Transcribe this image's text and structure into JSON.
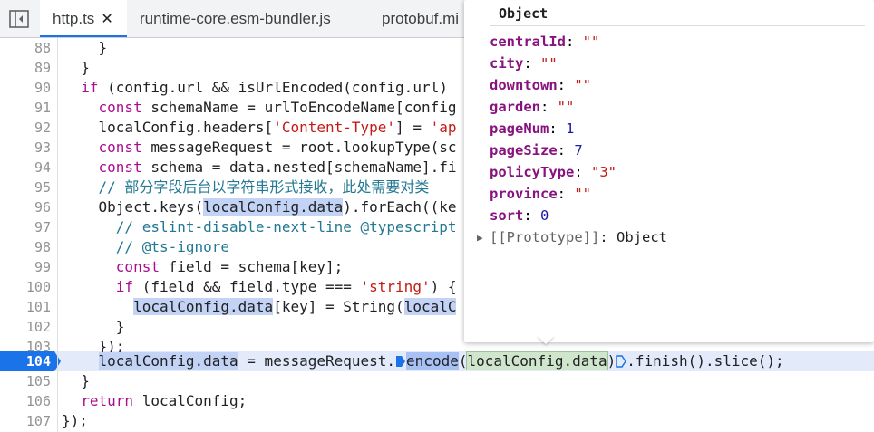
{
  "tabs": [
    {
      "label": "http.ts",
      "close": "✕",
      "active": true
    },
    {
      "label": "runtime-core.esm-bundler.js",
      "active": false
    },
    {
      "label": "protobuf.mi",
      "active": false
    }
  ],
  "gutter": {
    "line_numbers": [
      "88",
      "89",
      "90",
      "91",
      "92",
      "93",
      "94",
      "95",
      "96",
      "97",
      "98",
      "99",
      "100",
      "101",
      "102",
      "103",
      "104",
      "105",
      "106",
      "107"
    ],
    "current_line": "104"
  },
  "code": {
    "l88": "    }",
    "l89": "  }",
    "l90_kw": "if",
    "l90_rest": " (config.url && isUrlEncoded(config.url)",
    "l91_kw": "const",
    "l91_rest": " schemaName = urlToEncodeName[config",
    "l92_pre": "    localConfig.headers[",
    "l92_str": "'Content-Type'",
    "l92_mid": "] = ",
    "l92_str2": "'ap",
    "l93_kw": "const",
    "l93_rest": " messageRequest = root.lookupType(sc",
    "l94_kw": "const",
    "l94_rest": " schema = data.nested[schemaName].fi",
    "l95_cmt": "// 部分字段后台以字符串形式接收，此处需要对类",
    "l96_pre": "    Object.keys(",
    "l96_hl": "localConfig.data",
    "l96_post": ").forEach((ke",
    "l97_cmt": "// eslint-disable-next-line @typescript",
    "l98_cmt": "// @ts-ignore",
    "l99_kw": "const",
    "l99_rest": " field = schema[key];",
    "l100_kw": "if",
    "l100_pre": " (field && field.type === ",
    "l100_str": "'string'",
    "l100_post": ") {",
    "l101_hl": "localConfig.data",
    "l101_mid": "[key] = String(",
    "l101_hl2": "localC",
    "l102": "      }",
    "l103": "    });",
    "l104_hl": "localConfig.data",
    "l104_mid": " = messageRequest.",
    "l104_enc": "encode",
    "l104_paren": "(",
    "l104_arg": "localConfig.data",
    "l104_close": ")",
    "l104_tail": ".finish().slice();",
    "l105": "  }",
    "l106_kw": "return",
    "l106_rest": " localConfig;",
    "l107": "});"
  },
  "popover": {
    "title": "Object",
    "props": [
      {
        "key": "centralId",
        "value": "\"\"",
        "type": "str"
      },
      {
        "key": "city",
        "value": "\"\"",
        "type": "str"
      },
      {
        "key": "downtown",
        "value": "\"\"",
        "type": "str"
      },
      {
        "key": "garden",
        "value": "\"\"",
        "type": "str"
      },
      {
        "key": "pageNum",
        "value": "1",
        "type": "num"
      },
      {
        "key": "pageSize",
        "value": "7",
        "type": "num"
      },
      {
        "key": "policyType",
        "value": "\"3\"",
        "type": "str"
      },
      {
        "key": "province",
        "value": "\"\"",
        "type": "str"
      },
      {
        "key": "sort",
        "value": "0",
        "type": "num"
      }
    ],
    "prototype_label": "[[Prototype]]",
    "prototype_value": "Object"
  }
}
